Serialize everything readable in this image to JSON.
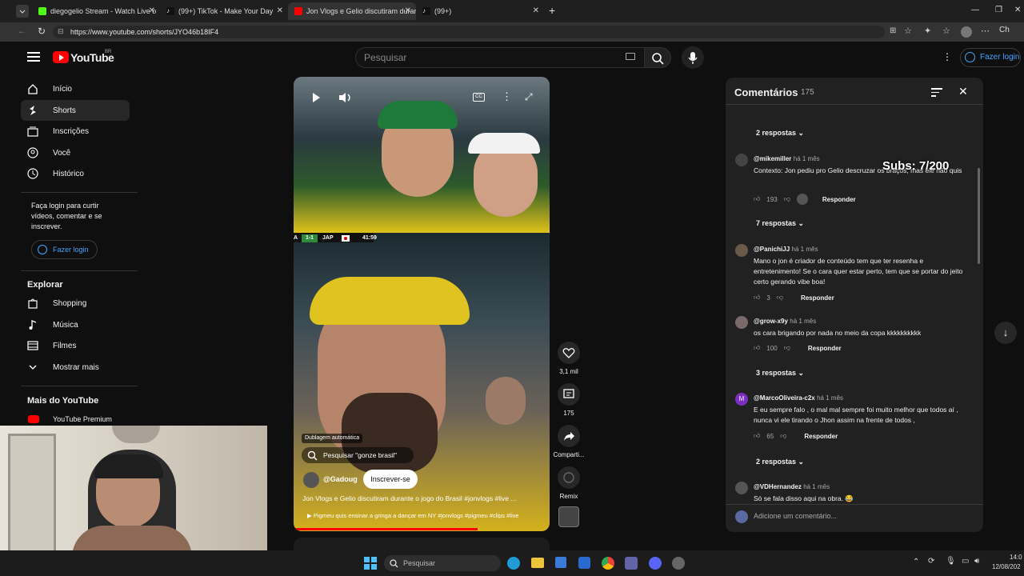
{
  "browser": {
    "tabs": [
      {
        "title": "diegogelio Stream - Watch Live o",
        "fav_color": "#53fc18"
      },
      {
        "title": "(99+) TikTok - Make Your Day",
        "fav_color": "#ffffff"
      },
      {
        "title": "Jon Vlogs e Gelio discutiram durar",
        "fav_color": "#ff0000"
      },
      {
        "title": "(99+)",
        "fav_color": "#ffffff"
      }
    ],
    "url": "https://www.youtube.com/shorts/JYO46b18IF4",
    "profile_label": "Ch"
  },
  "header": {
    "logo": "YouTube",
    "country": "BR",
    "search_placeholder": "Pesquisar",
    "login": "Fazer login"
  },
  "sidebar": {
    "items": [
      {
        "label": "Início",
        "icon": "home-icon"
      },
      {
        "label": "Shorts",
        "icon": "shorts-icon"
      },
      {
        "label": "Inscrições",
        "icon": "subscriptions-icon"
      },
      {
        "label": "Você",
        "icon": "user-icon"
      },
      {
        "label": "Histórico",
        "icon": "history-icon"
      }
    ],
    "login_prompt": "Faça login para curtir vídeos, comentar e se inscrever.",
    "login_button": "Fazer login",
    "explore_title": "Explorar",
    "explore": [
      {
        "label": "Shopping",
        "icon": "shopping-icon"
      },
      {
        "label": "Música",
        "icon": "music-icon"
      },
      {
        "label": "Filmes",
        "icon": "film-icon"
      },
      {
        "label": "Mostrar mais",
        "icon": "chevron-down-icon"
      }
    ],
    "more_title": "Mais do YouTube",
    "more": [
      {
        "label": "YouTube Premium"
      }
    ]
  },
  "video": {
    "score_team1": "A",
    "score": "1-1",
    "score_team2": "JAP",
    "clock": "41:59",
    "dub_badge": "Dublagem automática",
    "search_chip": "Pesquisar \"gonze brasil\"",
    "channel": "@Gadoug",
    "subscribe": "Inscrever-se",
    "title": "Jon Vlogs e Gelio discutiram durante o jogo do Brasil #jonvlogs #live ...",
    "related": "Pigmeu quis ensinar a gringa a dançar em NY #jonvlogs #pigmeu #clips #live",
    "likes": "3,1 mil",
    "comment_count": "175",
    "share": "Comparti...",
    "remix": "Remix"
  },
  "comments": {
    "title": "Comentários",
    "count": "175",
    "overlay": "Subs: 7/200",
    "reply_label": "Responder",
    "items": [
      {
        "user": "@mikemiller",
        "time": "há 1 mês",
        "text": "Contexto: Jon pediu pro Gelio descruzar os braços, mas ele não quis",
        "likes": "193",
        "replies": "7 respostas",
        "av": "#444"
      },
      {
        "user": "@PanichiJJ",
        "time": "há 1 mês",
        "text": "Mano o jon é criador de conteúdo tem que ter resenha e entretenimento! Se o cara quer estar perto, tem que se portar do jeito certo gerando vibe boa!",
        "likes": "3",
        "replies": "",
        "av": "#6a5a4a"
      },
      {
        "user": "@grow-x9y",
        "time": "há 1 mês",
        "text": "os cara brigando por nada no meio da copa kkkkkkkkkk",
        "likes": "100",
        "replies": "3 respostas",
        "av": "#7a6a6a"
      },
      {
        "user": "@MarcoOliveira-c2x",
        "time": "há 1 mês",
        "text": "E eu sempre falo , o mal mal sempre foi muito melhor que todos aí , nunca vi ele tirando o Jhon assim na frente de todos ,",
        "likes": "65",
        "replies": "2 respostas",
        "av": "#7b2fbe"
      },
      {
        "user": "@VDHernandez",
        "time": "há 1 mês",
        "text": "Só se fala disso aqui na obra. 😂",
        "likes": "",
        "replies": "",
        "av": "#555"
      }
    ],
    "top_replies": "2 respostas",
    "add_placeholder": "Adicione um comentário..."
  },
  "taskbar": {
    "search": "Pesquisar",
    "time": "14:0",
    "date": "12/08/202"
  }
}
